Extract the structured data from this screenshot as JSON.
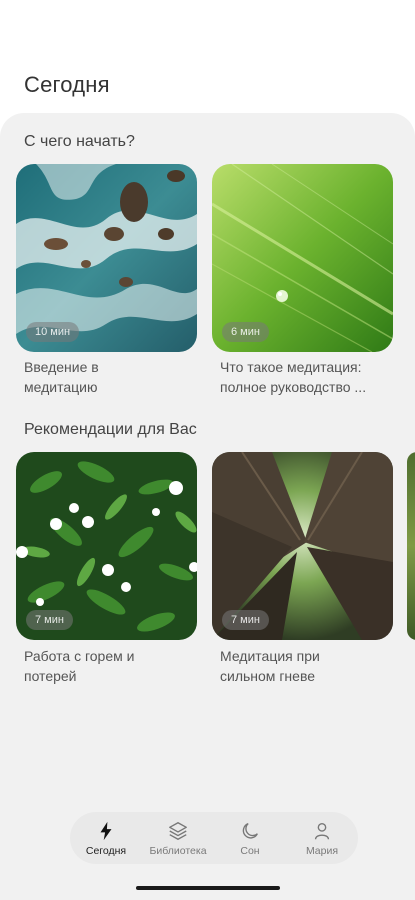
{
  "page": {
    "title": "Сегодня"
  },
  "sections": [
    {
      "title": "С чего начать?",
      "cards": [
        {
          "duration": "10 мин",
          "title_lines": [
            "Введение в",
            "медитацию"
          ],
          "image": "ocean-rocks-aerial"
        },
        {
          "duration": "6 мин",
          "title_lines": [
            "Что такое медитация:",
            "полное руководство ..."
          ],
          "image": "green-leaf-water-drop"
        }
      ]
    },
    {
      "title": "Рекомендации для Вас",
      "cards": [
        {
          "duration": "7 мин",
          "title_lines": [
            "Работа с горем и",
            "потерей"
          ],
          "image": "white-flowers-leaves"
        },
        {
          "duration": "7 мин",
          "title_lines": [
            "Медитация при",
            "сильном гневе"
          ],
          "image": "forest-canopy"
        }
      ]
    }
  ],
  "tabbar": {
    "items": [
      {
        "label": "Сегодня",
        "icon": "lightning-icon",
        "active": true
      },
      {
        "label": "Библиотека",
        "icon": "layers-icon",
        "active": false
      },
      {
        "label": "Сон",
        "icon": "moon-icon",
        "active": false
      },
      {
        "label": "Мария",
        "icon": "person-icon",
        "active": false
      }
    ]
  },
  "colors": {
    "background": "#ffffff",
    "sheet": "#f1f1f1",
    "tabbar": "#e9e9e9",
    "text": "#444444"
  }
}
